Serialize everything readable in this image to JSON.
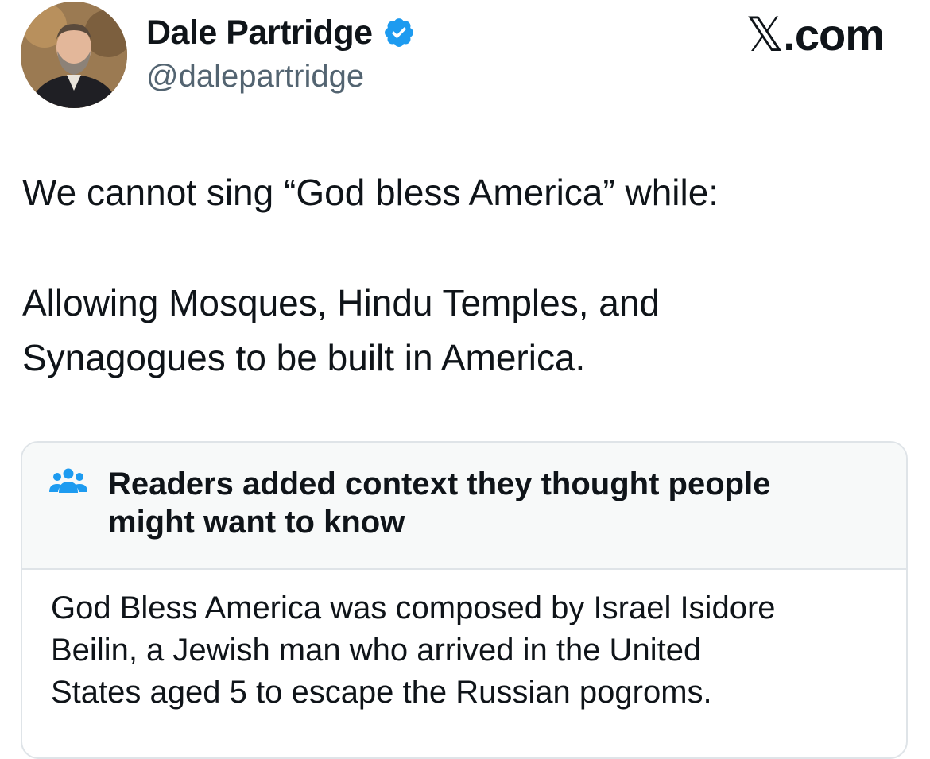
{
  "author": {
    "display_name": "Dale Partridge",
    "handle": "@dalepartridge",
    "verified": true
  },
  "brand": {
    "x_glyph": "𝕏",
    "suffix": ".com"
  },
  "tweet": {
    "line1": "We cannot sing “God bless America” while:",
    "para2_line1": "Allowing Mosques, Hindu Temples, and",
    "para2_line2": "Synagogues to be built in America."
  },
  "community_note": {
    "title_line1": "Readers added context they thought people",
    "title_line2": "might want to know",
    "body_line1": "God Bless America was composed  by Israel Isidore",
    "body_line2": "Beilin, a Jewish man who arrived in the United",
    "body_line3": "States aged 5 to escape the Russian pogroms."
  },
  "colors": {
    "verified": "#1d9bf0",
    "secondary_text": "#536471",
    "note_header_bg": "#f7f9f9",
    "border": "#dfe4e8"
  }
}
